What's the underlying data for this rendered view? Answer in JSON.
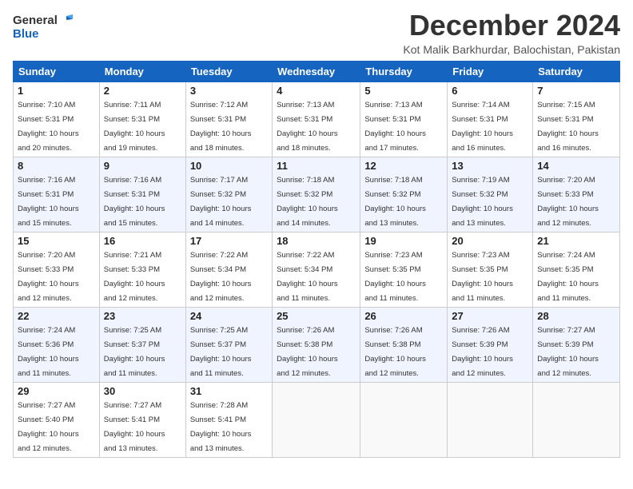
{
  "logo": {
    "line1": "General",
    "line2": "Blue"
  },
  "title": "December 2024",
  "subtitle": "Kot Malik Barkhurdar, Balochistan, Pakistan",
  "headers": [
    "Sunday",
    "Monday",
    "Tuesday",
    "Wednesday",
    "Thursday",
    "Friday",
    "Saturday"
  ],
  "weeks": [
    [
      {
        "day": "1",
        "sunrise": "7:10 AM",
        "sunset": "5:31 PM",
        "daylight": "10 hours and 20 minutes."
      },
      {
        "day": "2",
        "sunrise": "7:11 AM",
        "sunset": "5:31 PM",
        "daylight": "10 hours and 19 minutes."
      },
      {
        "day": "3",
        "sunrise": "7:12 AM",
        "sunset": "5:31 PM",
        "daylight": "10 hours and 18 minutes."
      },
      {
        "day": "4",
        "sunrise": "7:13 AM",
        "sunset": "5:31 PM",
        "daylight": "10 hours and 18 minutes."
      },
      {
        "day": "5",
        "sunrise": "7:13 AM",
        "sunset": "5:31 PM",
        "daylight": "10 hours and 17 minutes."
      },
      {
        "day": "6",
        "sunrise": "7:14 AM",
        "sunset": "5:31 PM",
        "daylight": "10 hours and 16 minutes."
      },
      {
        "day": "7",
        "sunrise": "7:15 AM",
        "sunset": "5:31 PM",
        "daylight": "10 hours and 16 minutes."
      }
    ],
    [
      {
        "day": "8",
        "sunrise": "7:16 AM",
        "sunset": "5:31 PM",
        "daylight": "10 hours and 15 minutes."
      },
      {
        "day": "9",
        "sunrise": "7:16 AM",
        "sunset": "5:31 PM",
        "daylight": "10 hours and 15 minutes."
      },
      {
        "day": "10",
        "sunrise": "7:17 AM",
        "sunset": "5:32 PM",
        "daylight": "10 hours and 14 minutes."
      },
      {
        "day": "11",
        "sunrise": "7:18 AM",
        "sunset": "5:32 PM",
        "daylight": "10 hours and 14 minutes."
      },
      {
        "day": "12",
        "sunrise": "7:18 AM",
        "sunset": "5:32 PM",
        "daylight": "10 hours and 13 minutes."
      },
      {
        "day": "13",
        "sunrise": "7:19 AM",
        "sunset": "5:32 PM",
        "daylight": "10 hours and 13 minutes."
      },
      {
        "day": "14",
        "sunrise": "7:20 AM",
        "sunset": "5:33 PM",
        "daylight": "10 hours and 12 minutes."
      }
    ],
    [
      {
        "day": "15",
        "sunrise": "7:20 AM",
        "sunset": "5:33 PM",
        "daylight": "10 hours and 12 minutes."
      },
      {
        "day": "16",
        "sunrise": "7:21 AM",
        "sunset": "5:33 PM",
        "daylight": "10 hours and 12 minutes."
      },
      {
        "day": "17",
        "sunrise": "7:22 AM",
        "sunset": "5:34 PM",
        "daylight": "10 hours and 12 minutes."
      },
      {
        "day": "18",
        "sunrise": "7:22 AM",
        "sunset": "5:34 PM",
        "daylight": "10 hours and 11 minutes."
      },
      {
        "day": "19",
        "sunrise": "7:23 AM",
        "sunset": "5:35 PM",
        "daylight": "10 hours and 11 minutes."
      },
      {
        "day": "20",
        "sunrise": "7:23 AM",
        "sunset": "5:35 PM",
        "daylight": "10 hours and 11 minutes."
      },
      {
        "day": "21",
        "sunrise": "7:24 AM",
        "sunset": "5:35 PM",
        "daylight": "10 hours and 11 minutes."
      }
    ],
    [
      {
        "day": "22",
        "sunrise": "7:24 AM",
        "sunset": "5:36 PM",
        "daylight": "10 hours and 11 minutes."
      },
      {
        "day": "23",
        "sunrise": "7:25 AM",
        "sunset": "5:37 PM",
        "daylight": "10 hours and 11 minutes."
      },
      {
        "day": "24",
        "sunrise": "7:25 AM",
        "sunset": "5:37 PM",
        "daylight": "10 hours and 11 minutes."
      },
      {
        "day": "25",
        "sunrise": "7:26 AM",
        "sunset": "5:38 PM",
        "daylight": "10 hours and 12 minutes."
      },
      {
        "day": "26",
        "sunrise": "7:26 AM",
        "sunset": "5:38 PM",
        "daylight": "10 hours and 12 minutes."
      },
      {
        "day": "27",
        "sunrise": "7:26 AM",
        "sunset": "5:39 PM",
        "daylight": "10 hours and 12 minutes."
      },
      {
        "day": "28",
        "sunrise": "7:27 AM",
        "sunset": "5:39 PM",
        "daylight": "10 hours and 12 minutes."
      }
    ],
    [
      {
        "day": "29",
        "sunrise": "7:27 AM",
        "sunset": "5:40 PM",
        "daylight": "10 hours and 12 minutes."
      },
      {
        "day": "30",
        "sunrise": "7:27 AM",
        "sunset": "5:41 PM",
        "daylight": "10 hours and 13 minutes."
      },
      {
        "day": "31",
        "sunrise": "7:28 AM",
        "sunset": "5:41 PM",
        "daylight": "10 hours and 13 minutes."
      },
      null,
      null,
      null,
      null
    ]
  ],
  "labels": {
    "sunrise": "Sunrise:",
    "sunset": "Sunset:",
    "daylight": "Daylight:"
  }
}
